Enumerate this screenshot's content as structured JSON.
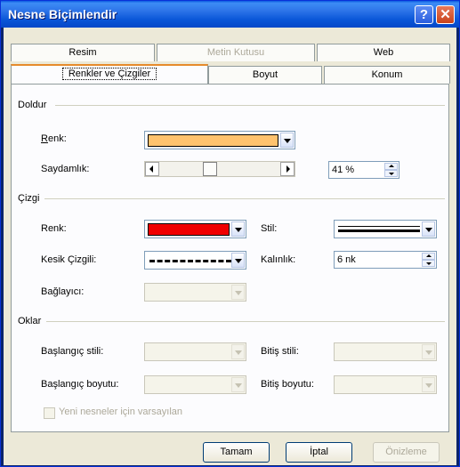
{
  "window": {
    "title": "Nesne Biçimlendir",
    "help_label": "?",
    "close_label": "✕"
  },
  "tabs": {
    "row1": [
      {
        "label": "Resim"
      },
      {
        "label": "Metin Kutusu"
      },
      {
        "label": "Web"
      }
    ],
    "row2": [
      {
        "label": "Renkler ve Çizgiler"
      },
      {
        "label": "Boyut"
      },
      {
        "label": "Konum"
      }
    ]
  },
  "doldur": {
    "heading": "Doldur",
    "renk_label": "Renk:",
    "renk_color": "#ffc36e",
    "saydamlik_label": "Saydamlık:",
    "saydamlik_value": "41 %",
    "saydamlik_percent": 41
  },
  "cizgi": {
    "heading": "Çizgi",
    "renk_label": "Renk:",
    "renk_color": "#f00000",
    "stil_label": "Stil:",
    "kesik_label": "Kesik Çizgili:",
    "kalinlik_label": "Kalınlık:",
    "kalinlik_value": "6 nk",
    "baglayici_label": "Bağlayıcı:"
  },
  "oklar": {
    "heading": "Oklar",
    "baslangic_stili_label": "Başlangıç stili:",
    "bitis_stili_label": "Bitiş stili:",
    "baslangic_boyutu_label": "Başlangıç boyutu:",
    "bitis_boyutu_label": "Bitiş boyutu:"
  },
  "checkbox": {
    "label": "Yeni nesneler için varsayılan"
  },
  "buttons": {
    "ok": "Tamam",
    "cancel": "İptal",
    "preview": "Önizleme"
  },
  "icons": [
    "help-icon",
    "close-icon",
    "chevron-down-icon",
    "arrow-left-icon",
    "arrow-right-icon",
    "spin-up-icon",
    "spin-down-icon"
  ]
}
